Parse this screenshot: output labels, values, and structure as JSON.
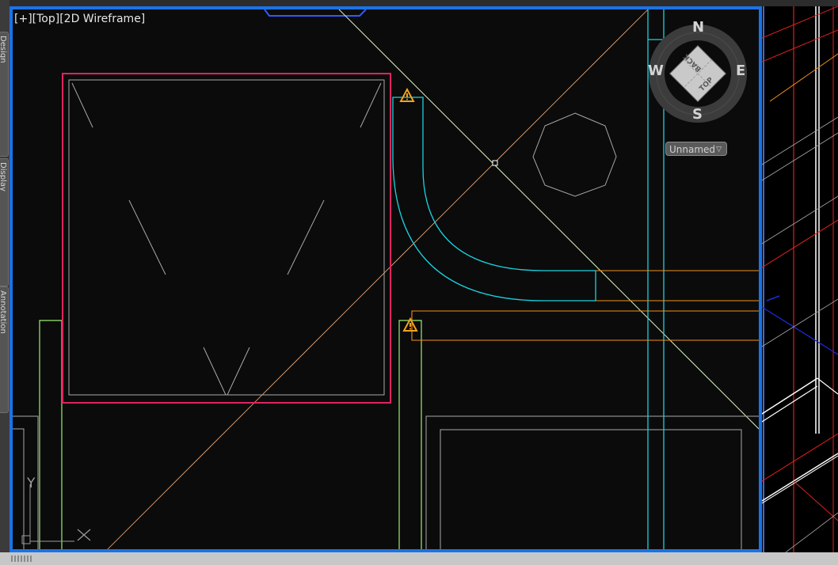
{
  "viewport": {
    "controls_label": "[+][Top][2D Wireframe]"
  },
  "left_panel": {
    "tabs": [
      {
        "label": "Design"
      },
      {
        "label": "Display"
      },
      {
        "label": "Annotation"
      }
    ]
  },
  "viewcube": {
    "compass": {
      "north": "N",
      "south": "S",
      "east": "E",
      "west": "W"
    },
    "faces": {
      "top": "TOP",
      "back": "BACK"
    },
    "ucs_menu": {
      "label": "Unnamed",
      "arrow": "▽"
    }
  },
  "ucs_icon": {
    "y_axis_label": "Y"
  },
  "colors": {
    "viewport_background": "#0b0b0b",
    "active_border": "#1a73e8",
    "selection_highlight": "#e0245e",
    "cyan_object": "#19d3e0",
    "orange_object": "#f0901a",
    "green_object": "#9bee70",
    "warning": "#f2a31c"
  },
  "icons": [
    "warning-icon",
    "ucs-icon",
    "viewcube",
    "grip-icon"
  ]
}
